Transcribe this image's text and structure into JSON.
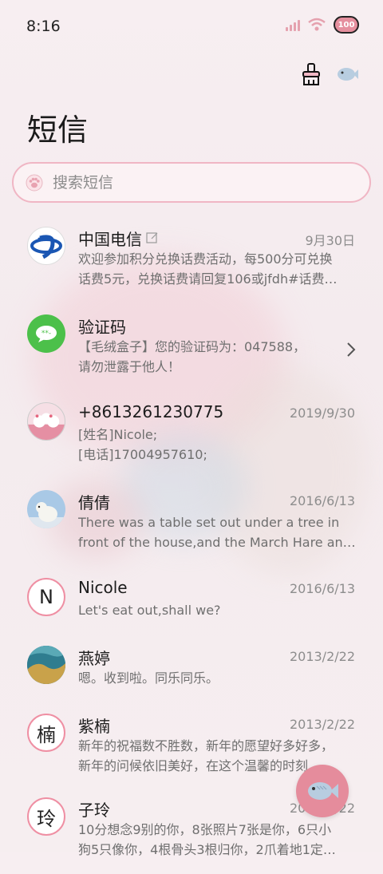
{
  "status": {
    "time": "8:16",
    "battery": "100"
  },
  "page": {
    "title": "短信"
  },
  "search": {
    "placeholder": "搜索短信"
  },
  "messages": [
    {
      "name": "中国电信",
      "date": "9月30日",
      "lines": [
        "欢迎参加积分兑换话费活动，每500分可兑换",
        "话费5元，兑换话费请回复106或jfdh#话费…"
      ],
      "avatar": "telecom-logo"
    },
    {
      "name": "验证码",
      "date": "",
      "lines": [
        "【毛绒盒子】您的验证码为：047588，",
        "请勿泄露于他人！"
      ],
      "avatar": "message-icon"
    },
    {
      "name": "+8613261230775",
      "date": "2019/9/30",
      "lines": [
        "[姓名]Nicole;",
        "[电话]17004957610;"
      ],
      "avatar": "photo-kitty"
    },
    {
      "name": "倩倩",
      "date": "2016/6/13",
      "lines": [
        "There was a table set out under a tree in",
        "front of the house,and the March Hare an…"
      ],
      "avatar": "photo-bear"
    },
    {
      "name": "Nicole",
      "date": "2016/6/13",
      "lines": [
        "Let's eat out,shall we?"
      ],
      "avatar": "letter",
      "letter": "N"
    },
    {
      "name": "燕婷",
      "date": "2013/2/22",
      "lines": [
        "嗯。收到啦。同乐同乐。"
      ],
      "avatar": "photo-sea"
    },
    {
      "name": "紫楠",
      "date": "2013/2/22",
      "lines": [
        "新年的祝福数不胜数，新年的愿望好多好多，",
        "新年的问候依旧美好，在这个温馨的时刻，…"
      ],
      "avatar": "letter",
      "letter": "楠"
    },
    {
      "name": "子玲",
      "date": "2013/2/22",
      "lines": [
        "10分想念9别的你，8张照片7张是你，6只小",
        "狗5只像你，4根骨头3根归你，2爪着地1定…"
      ],
      "avatar": "letter",
      "letter": "玲"
    }
  ],
  "colors": {
    "accent": "#e58c9c",
    "border": "#f0b6c4"
  }
}
